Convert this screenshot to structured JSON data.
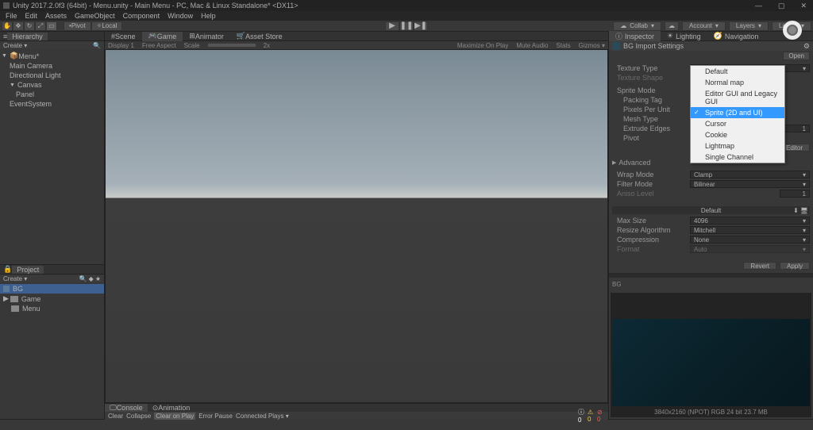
{
  "titlebar": {
    "title": "Unity 2017.2.0f3 (64bit) - Menu.unity - Main Menu - PC, Mac & Linux Standalone* <DX11>",
    "minimize": "—",
    "maximize": "▢",
    "close": "✕"
  },
  "menubar": {
    "items": [
      "File",
      "Edit",
      "Assets",
      "GameObject",
      "Component",
      "Window",
      "Help"
    ]
  },
  "toolbar": {
    "pivot": "Pivot",
    "local": "Local",
    "collab": "Collab",
    "account": "Account",
    "layers": "Layers",
    "layout": "Layout"
  },
  "hierarchy": {
    "tab": "Hierarchy",
    "create": "Create",
    "scene": "Menu*",
    "items": [
      "Main Camera",
      "Directional Light",
      "Canvas",
      "Panel",
      "EventSystem"
    ]
  },
  "project": {
    "tab": "Project",
    "create": "Create",
    "items": [
      {
        "name": "BG",
        "selected": true,
        "type": "file"
      },
      {
        "name": "Game",
        "type": "folder"
      },
      {
        "name": "Menu",
        "type": "folder"
      }
    ]
  },
  "viewTabs": {
    "scene": "Scene",
    "game": "Game",
    "animator": "Animator",
    "assetStore": "Asset Store"
  },
  "viewToolbar": {
    "display": "Display 1",
    "aspect": "Free Aspect",
    "scale": "Scale",
    "scaleVal": "2x",
    "maximize": "Maximize On Play",
    "mute": "Mute Audio",
    "stats": "Stats",
    "gizmos": "Gizmos"
  },
  "console": {
    "tab": "Console",
    "animation": "Animation",
    "clear": "Clear",
    "collapse": "Collapse",
    "clearOnPlay": "Clear on Play",
    "errorPause": "Error Pause",
    "connectedPlays": "Connected Plays"
  },
  "inspector": {
    "tabs": {
      "inspector": "Inspector",
      "lighting": "Lighting",
      "navigation": "Navigation"
    },
    "title": "BG Import Settings",
    "open": "Open",
    "textureType": {
      "label": "Texture Type",
      "value": "Sprite (2D and UI)"
    },
    "textureShape": {
      "label": "Texture Shape"
    },
    "spriteMode": {
      "label": "Sprite Mode"
    },
    "packingTag": {
      "label": "Packing Tag"
    },
    "pixelsPerUnit": {
      "label": "Pixels Per Unit"
    },
    "meshType": {
      "label": "Mesh Type"
    },
    "extrudeEdges": {
      "label": "Extrude Edges"
    },
    "pivot": {
      "label": "Pivot"
    },
    "spriteEditorBtn": "...rite Editor",
    "advanced": "Advanced",
    "wrapMode": {
      "label": "Wrap Mode",
      "value": "Clamp"
    },
    "filterMode": {
      "label": "Filter Mode",
      "value": "Bilinear"
    },
    "anisoLevel": {
      "label": "Aniso Level",
      "value": "1"
    },
    "default": "Default",
    "maxSize": {
      "label": "Max Size",
      "value": "4096"
    },
    "resizeAlgorithm": {
      "label": "Resize Algorithm",
      "value": "Mitchell"
    },
    "compression": {
      "label": "Compression",
      "value": "None"
    },
    "format": {
      "label": "Format",
      "value": "Auto"
    },
    "revert": "Revert",
    "apply": "Apply",
    "bgLabel": "BG",
    "previewInfo": "3840x2160 (NPOT)  RGB 24 bit  23.7 MB"
  },
  "dropdown": {
    "items": [
      "Default",
      "Normal map",
      "Editor GUI and Legacy GUI",
      "Sprite (2D and UI)",
      "Cursor",
      "Cookie",
      "Lightmap",
      "Single Channel"
    ],
    "selectedIndex": 3
  }
}
